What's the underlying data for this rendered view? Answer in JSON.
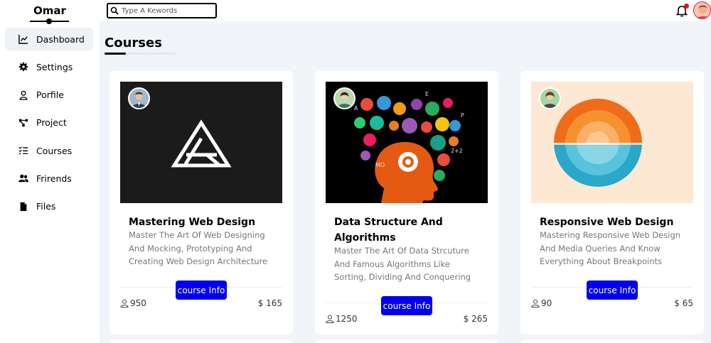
{
  "sidebar": {
    "brand": "Omar",
    "items": [
      {
        "label": "Dashboard",
        "icon": "chart-line-icon",
        "active": true
      },
      {
        "label": "Settings",
        "icon": "gear-icon"
      },
      {
        "label": "Porfile",
        "icon": "user-icon"
      },
      {
        "label": "Project",
        "icon": "diagram-project-icon"
      },
      {
        "label": "Courses",
        "icon": "list-check-icon"
      },
      {
        "label": "Frirends",
        "icon": "users-icon"
      },
      {
        "label": "Files",
        "icon": "file-icon"
      }
    ]
  },
  "header": {
    "search_placeholder": "Type A Kewords",
    "notification_icon": "bell-icon",
    "notification_dot_color": "#e11d1d"
  },
  "page": {
    "title": "Courses"
  },
  "courses": [
    {
      "title": "Mastering Web Design",
      "description": "Master The Art Of Web Designing And Mocking, Prototyping And Creating Web Design Architecture",
      "button": "course Info",
      "students": "950",
      "price": "$ 165"
    },
    {
      "title": "Data Structure And Algorithms",
      "description": "Master The Art Of Data Strcuture And Famous Algorithms Like Sorting, Dividing And Conquering",
      "button": "course Info",
      "students": "1250",
      "price": "$ 265"
    },
    {
      "title": "Responsive Web Design",
      "description": "Mastering Responsive Web Design And Media Queries And Know Everything About Breakpoints",
      "button": "course Info",
      "students": "90",
      "price": "$ 65"
    }
  ],
  "colors": {
    "accent_button": "#0000ee",
    "background": "#f1f5f9"
  }
}
